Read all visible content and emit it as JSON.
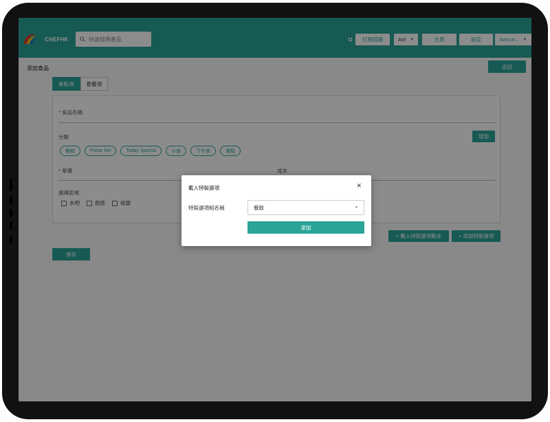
{
  "header": {
    "brand": "CHEFHK",
    "search_placeholder": "快速搜尋產品",
    "buttons": {
      "open_drawer": "打開錢箱",
      "am": "AM",
      "home": "主頁",
      "settings": "設定",
      "account": "Amour..."
    }
  },
  "page": {
    "title": "添加食品",
    "back_button": "返回",
    "tabs": [
      "單點項",
      "套餐項"
    ],
    "form": {
      "name_label": "* 食品名稱",
      "category_label": "分類",
      "add_category_button": "增加",
      "categories": [
        "餐飲",
        "Pasta Set",
        "Today Special",
        "小食",
        "下午茶",
        "單點"
      ],
      "price_label": "* 單價",
      "cost_label": "成本",
      "area_label": "選擇區域",
      "areas": [
        "水吧",
        "廚房",
        "收銀"
      ]
    },
    "load_template_button": "+ 載入特製選項範本",
    "add_option_button": "+ 添加特製選項",
    "save_button": "保存"
  },
  "modal": {
    "title": "載入特製選項",
    "group_label": "特製選項組名稱",
    "selected_group": "餐飲",
    "add_button": "添加"
  },
  "colors": {
    "accent": "#2aa597",
    "bezel": "#111111",
    "overlay": "rgba(0,0,0,0.45)"
  }
}
